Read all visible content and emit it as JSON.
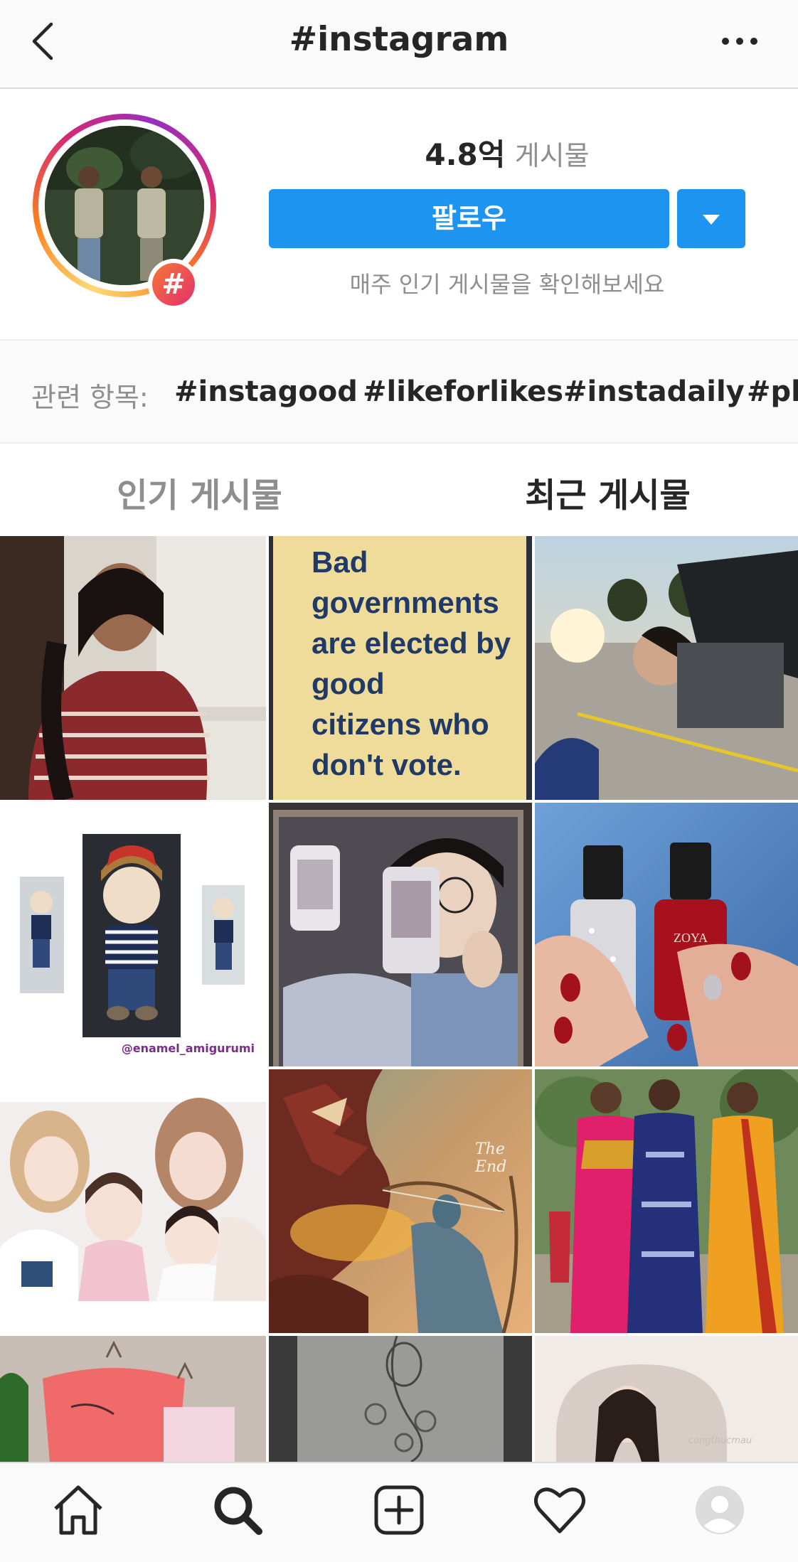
{
  "header": {
    "title": "#instagram",
    "back_icon": "chevron-left-icon",
    "more_icon": "more-horizontal-icon"
  },
  "profile": {
    "post_count": "4.8억",
    "post_count_label": "게시물",
    "follow_label": "팔로우",
    "weekly_caption": "매주 인기 게시물을 확인해보세요",
    "badge_symbol": "#"
  },
  "related": {
    "label": "관련 항목:",
    "tags": [
      "#instagood",
      "#likeforlikes",
      "#instadaily",
      "#ph"
    ]
  },
  "tabs": {
    "top": "인기 게시물",
    "recent": "최근 게시물"
  },
  "grid": {
    "quote_lines": [
      "Bad",
      "governments",
      "are elected by",
      "good",
      "citizens who",
      "don't vote."
    ],
    "amigurumi_handle": "@enamel_amigurumi",
    "the_end_text": "The End",
    "polish_brand": "ZOYA",
    "watermark_text": "congthucmau"
  },
  "nav": {
    "items": [
      "home-icon",
      "search-icon",
      "new-post-icon",
      "activity-heart-icon",
      "profile-avatar-icon"
    ],
    "active": "search-icon"
  },
  "colors": {
    "accent": "#1c94f0",
    "text": "#262626",
    "muted": "#8e8e8e"
  }
}
